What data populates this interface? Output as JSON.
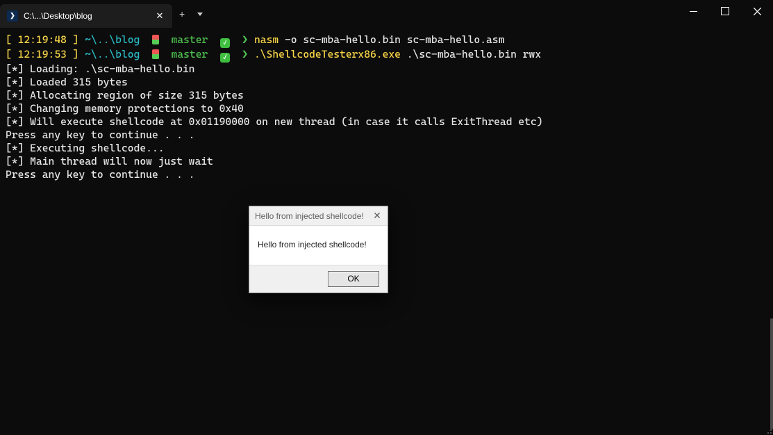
{
  "window": {
    "tab_title": "C:\\...\\Desktop\\blog",
    "new_tab_label": "+",
    "dropdown_label": ""
  },
  "prompt1": {
    "time_open": "[ ",
    "time": "12:19:48",
    "time_close": " ]",
    "path": "~\\..\\blog",
    "branch": "master",
    "chevron": "❯",
    "cmd_prog": "nasm",
    "cmd_args": " -o sc-mba-hello.bin sc-mba-hello.asm"
  },
  "prompt2": {
    "time_open": "[ ",
    "time": "12:19:53",
    "time_close": " ]",
    "path": "~\\..\\blog",
    "branch": "master",
    "chevron": "❯",
    "cmd_prog": ".\\ShellcodeTesterx86.exe",
    "cmd_args": " .\\sc-mba-hello.bin rwx"
  },
  "output": {
    "l1": "[*] Loading: .\\sc-mba-hello.bin",
    "l2": "[*] Loaded 315 bytes",
    "l3": "[*] Allocating region of size 315 bytes",
    "l4": "[*] Changing memory protections to 0x40",
    "l5": "[*] Will execute shellcode at 0x01190000 on new thread (in case it calls ExitThread etc)",
    "l6": "Press any key to continue . . .",
    "l7": "[*] Executing shellcode...",
    "l8": "[*] Main thread will now just wait",
    "l9": "Press any key to continue . . ."
  },
  "msgbox": {
    "title": "Hello from injected shellcode!",
    "body": "Hello from injected shellcode!",
    "ok": "OK"
  }
}
